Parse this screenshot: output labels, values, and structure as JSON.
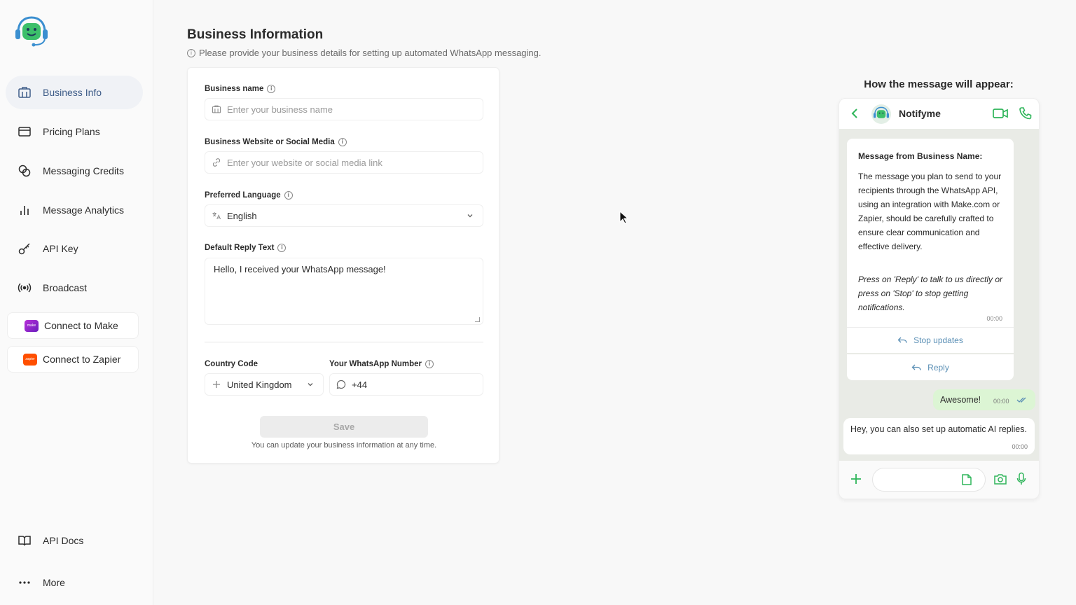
{
  "sidebar": {
    "items": [
      {
        "label": "Business Info",
        "icon": "building-icon"
      },
      {
        "label": "Pricing Plans",
        "icon": "credit-card-icon"
      },
      {
        "label": "Messaging Credits",
        "icon": "coins-icon"
      },
      {
        "label": "Message Analytics",
        "icon": "bar-chart-icon"
      },
      {
        "label": "API Key",
        "icon": "key-icon"
      },
      {
        "label": "Broadcast",
        "icon": "broadcast-icon"
      }
    ],
    "integrations": [
      {
        "label": "Connect to Make",
        "badge_color": "#8b2ecb"
      },
      {
        "label": "Connect to Zapier",
        "badge_color": "#ff4f00"
      }
    ],
    "bottom": [
      {
        "label": "API Docs",
        "icon": "book-icon"
      },
      {
        "label": "More",
        "icon": "more-icon"
      }
    ]
  },
  "header": {
    "title": "Business Information",
    "subtitle": "Please provide your business details for setting up automated WhatsApp messaging."
  },
  "form": {
    "business_name_label": "Business name",
    "business_name_placeholder": "Enter your business name",
    "website_label": "Business Website or Social Media",
    "website_placeholder": "Enter your website or social media link",
    "language_label": "Preferred Language",
    "language_value": "English",
    "reply_label": "Default Reply Text",
    "reply_value": "Hello, I received your WhatsApp message!",
    "country_label": "Country Code",
    "country_value": "United Kingdom",
    "whatsapp_label": "Your WhatsApp Number",
    "whatsapp_value": "+44",
    "save_label": "Save",
    "save_note": "You can update your business information at any time."
  },
  "preview": {
    "title": "How the message will appear:",
    "contact_name": "Notifyme",
    "message_header": "Message from Business Name:",
    "message_body": "The message you plan to send to your recipients through the WhatsApp API, using an integration with Make.com or Zapier, should be carefully crafted to ensure clear communication and effective delivery.",
    "message_italic": "Press on 'Reply' to talk to us directly or press on 'Stop' to stop getting notifications.",
    "message_time": "00:00",
    "action_stop": "Stop updates",
    "action_reply": "Reply",
    "outgoing_text": "Awesome!",
    "outgoing_time": "00:00",
    "incoming_text": "Hey, you can also set up automatic AI replies.",
    "incoming_time": "00:00"
  },
  "colors": {
    "accent": "#3e5c88",
    "whatsapp_green": "#2fb55a",
    "bubble_out": "#dcf5d4",
    "link_blue": "#5a8fb5"
  }
}
